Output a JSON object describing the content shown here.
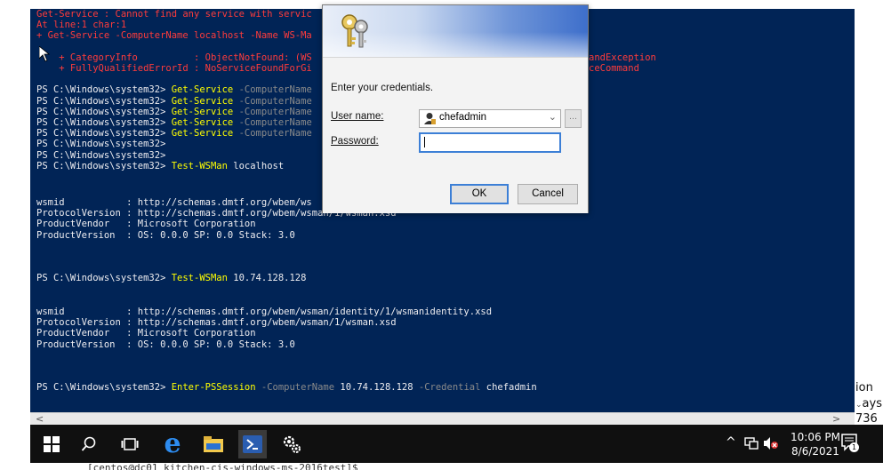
{
  "console": {
    "lines": [
      {
        "cls": "err",
        "text": "Get-Service : Cannot find any service with servic"
      },
      {
        "cls": "err",
        "text": "At line:1 char:1"
      },
      {
        "cls": "err",
        "text": "+ Get-Service -ComputerName localhost -Name WS-Ma"
      },
      {
        "cls": "",
        "text": ""
      },
      {
        "cls": "err",
        "text": "    + CategoryInfo          : ObjectNotFound: (WS"
      },
      {
        "cls": "err",
        "text": "    + FullyQualifiedErrorId : NoServiceFoundForGi"
      },
      {
        "cls": "",
        "text": ""
      },
      {
        "cls": "ps",
        "prompt": "PS C:\\Windows\\system32> ",
        "cmd": "Get-Service",
        "rest": " -ComputerName"
      },
      {
        "cls": "ps",
        "prompt": "PS C:\\Windows\\system32> ",
        "cmd": "Get-Service",
        "rest": " -ComputerName"
      },
      {
        "cls": "ps",
        "prompt": "PS C:\\Windows\\system32> ",
        "cmd": "Get-Service",
        "rest": " -ComputerName"
      },
      {
        "cls": "ps",
        "prompt": "PS C:\\Windows\\system32> ",
        "cmd": "Get-Service",
        "rest": " -ComputerName"
      },
      {
        "cls": "ps",
        "prompt": "PS C:\\Windows\\system32> ",
        "cmd": "Get-Service",
        "rest": " -ComputerName"
      },
      {
        "cls": "ps",
        "prompt": "PS C:\\Windows\\system32>",
        "cmd": "",
        "rest": ""
      },
      {
        "cls": "ps",
        "prompt": "PS C:\\Windows\\system32>",
        "cmd": "",
        "rest": ""
      },
      {
        "cls": "ps",
        "prompt": "PS C:\\Windows\\system32> ",
        "cmd": "Test-WSMan",
        "rest": " localhost",
        "restplain": true
      }
    ],
    "errRightLines": [
      "andException",
      "ceCommand"
    ],
    "block1": [
      "wsmid           : http://schemas.dmtf.org/wbem/ws",
      "ProtocolVersion : http://schemas.dmtf.org/wbem/wsman/1/wsman.xsd",
      "ProductVendor   : Microsoft Corporation",
      "ProductVersion  : OS: 0.0.0 SP: 0.0 Stack: 3.0"
    ],
    "cmd2": {
      "prompt": "PS C:\\Windows\\system32> ",
      "cmd": "Test-WSMan",
      "rest": " 10.74.128.128"
    },
    "block2": [
      "wsmid           : http://schemas.dmtf.org/wbem/wsman/identity/1/wsmanidentity.xsd",
      "ProtocolVersion : http://schemas.dmtf.org/wbem/wsman/1/wsman.xsd",
      "ProductVendor   : Microsoft Corporation",
      "ProductVersion  : OS: 0.0.0 SP: 0.0 Stack: 3.0"
    ],
    "cmd3": {
      "prompt": "PS C:\\Windows\\system32> ",
      "cmd": "Enter-PSSession",
      "p1": " -ComputerName",
      "v1": " 10.74.128.128",
      "p2": " -Credential",
      "v2": " chefadmin"
    }
  },
  "edge_text": [
    "ion",
    "ays",
    "736"
  ],
  "dialog": {
    "prompt": "Enter your credentials.",
    "username_label": "User name:",
    "username_value": "chefadmin",
    "password_label": "Password:",
    "ok": "OK",
    "cancel": "Cancel"
  },
  "taskbar": {
    "time": "10:06 PM",
    "date": "8/6/2021",
    "notification_count": "1"
  },
  "bottom_text": "[centos@dc01 kitchen-cis-windows-ms-2016test]$",
  "colors": {
    "console_bg": "#012456",
    "error": "#ff3b3b",
    "command": "#ffff00",
    "param": "#8a8a8a"
  }
}
